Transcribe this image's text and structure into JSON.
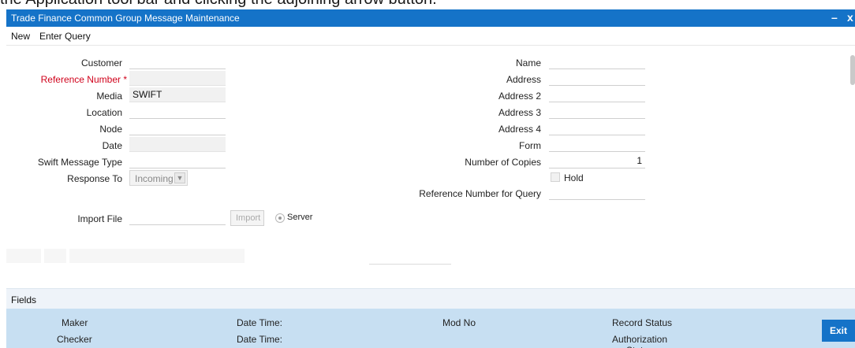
{
  "caption": "the Application tool bar and clicking the adjoining arrow button.",
  "window": {
    "title": "Trade Finance Common Group Message Maintenance",
    "minimize_glyph": "–",
    "close_glyph": "x"
  },
  "menu": {
    "new": "New",
    "enter_query": "Enter Query"
  },
  "form": {
    "customer_label": "Customer",
    "customer_value": "",
    "reference_label": "Reference Number *",
    "reference_value": "",
    "media_label": "Media",
    "media_value": "SWIFT",
    "location_label": "Location",
    "location_value": "",
    "node_label": "Node",
    "node_value": "",
    "date_label": "Date",
    "date_value": "",
    "swift_type_label": "Swift Message Type",
    "swift_type_value": "",
    "response_label": "Response To",
    "response_value": "Incoming",
    "name_label": "Name",
    "name_value": "",
    "address_label": "Address",
    "address_value": "",
    "address2_label": "Address 2",
    "address2_value": "",
    "address3_label": "Address 3",
    "address3_value": "",
    "address4_label": "Address 4",
    "address4_value": "",
    "form_label": "Form",
    "form_value": "",
    "copies_label": "Number of Copies",
    "copies_value": "1",
    "hold_label": "Hold",
    "hold_checked": false,
    "ref_query_label": "Reference Number for Query",
    "ref_query_value": "",
    "import_label": "Import File",
    "import_value": "",
    "import_button": "Import",
    "server_label": "Server"
  },
  "fields_bar": {
    "label": "Fields"
  },
  "footer": {
    "maker": "Maker",
    "checker": "Checker",
    "date_time_1": "Date Time:",
    "date_time_2": "Date Time:",
    "mod_no": "Mod No",
    "record_status": "Record Status",
    "auth_status": "Authorization Status",
    "exit": "Exit"
  },
  "colors": {
    "titlebar": "#1573c8",
    "footer": "#c7dff2",
    "required": "#d0021b",
    "exit_button": "#1573c8"
  }
}
